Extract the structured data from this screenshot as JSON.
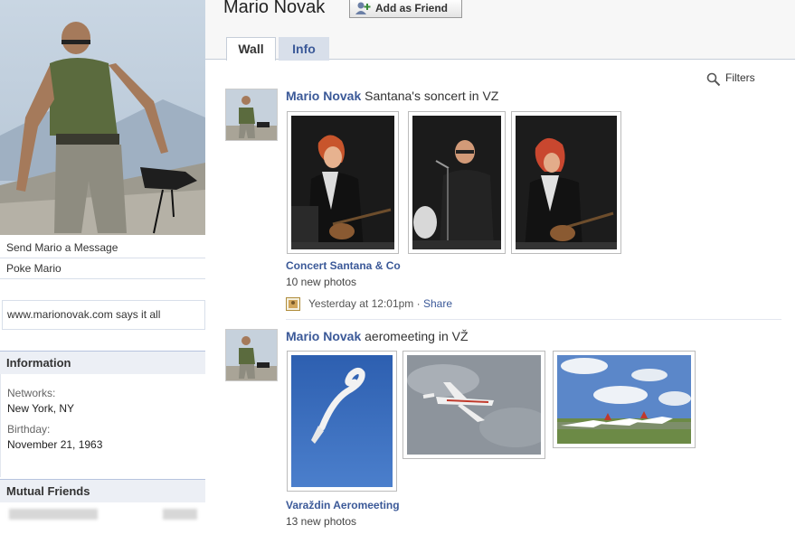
{
  "profile": {
    "name": "Mario Novak"
  },
  "actions": {
    "add_friend": "Add as Friend"
  },
  "tabs": {
    "wall": "Wall",
    "info": "Info"
  },
  "sidebar": {
    "send_message": "Send Mario a Message",
    "poke": "Poke Mario",
    "website": "www.marionovak.com says it all",
    "information": {
      "title": "Information",
      "networks_label": "Networks:",
      "networks_value": "New York, NY",
      "birthday_label": "Birthday:",
      "birthday_value": "November 21, 1963"
    },
    "mutual_friends": {
      "title": "Mutual Friends"
    }
  },
  "feed": {
    "filters": "Filters",
    "posts": [
      {
        "actor": "Mario Novak",
        "text": "Santana's soncert in VZ",
        "album": "Concert Santana & Co",
        "count": "10 new photos",
        "time": "Yesterday at 12:01pm",
        "separator": " · ",
        "share": "Share"
      },
      {
        "actor": "Mario Novak",
        "text": "aeromeeting in VŽ",
        "album": "Varaždin Aeromeeting",
        "count": "13 new photos"
      }
    ]
  },
  "colors": {
    "link": "#3b5998",
    "header_bg": "#eceff5",
    "border": "#d8dfea"
  }
}
